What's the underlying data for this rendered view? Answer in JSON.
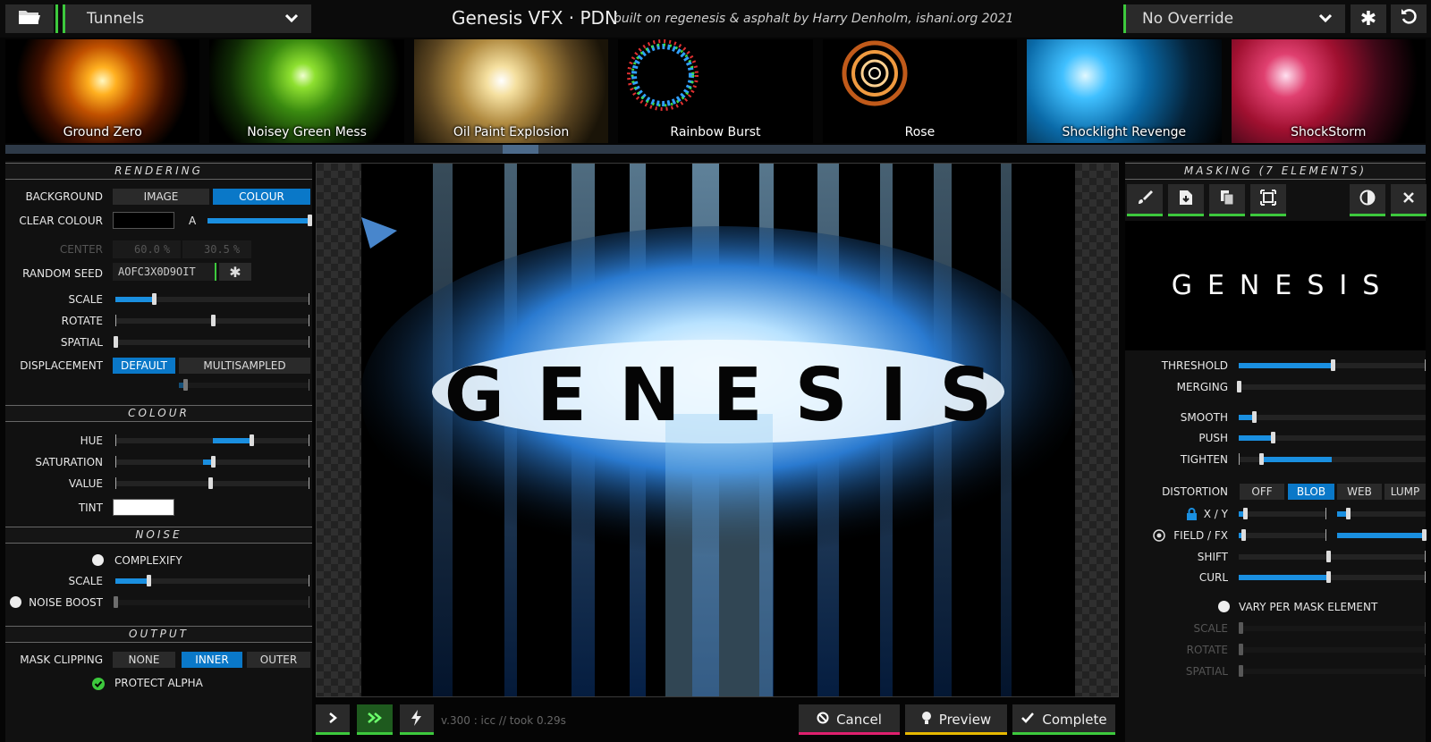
{
  "header": {
    "preset": "Tunnels",
    "title": "Genesis VFX · PDN",
    "credit": "built on regenesis & asphalt by Harry Denholm, ishani.org 2021",
    "override": "No Override"
  },
  "presets": [
    {
      "label": "Ground Zero"
    },
    {
      "label": "Noisey Green Mess"
    },
    {
      "label": "Oil Paint Explosion"
    },
    {
      "label": "Rainbow Burst"
    },
    {
      "label": "Rose"
    },
    {
      "label": "Shocklight Revenge"
    },
    {
      "label": "ShockStorm"
    }
  ],
  "rendering": {
    "heading": "RENDERING",
    "background_label": "BACKGROUND",
    "background_options": [
      "IMAGE",
      "COLOUR"
    ],
    "background_selected": "COLOUR",
    "clear_colour_label": "CLEAR COLOUR",
    "clear_colour": "#000000",
    "alpha_label": "A",
    "alpha_value": 1.0,
    "center_label": "CENTER",
    "center_x": "60.0",
    "center_y": "30.5",
    "pct": "%",
    "seed_label": "RANDOM SEED",
    "seed": "AOFC3X0D9OIT",
    "scale_label": "SCALE",
    "scale_value": 0.2,
    "rotate_label": "ROTATE",
    "rotate_value": 0.5,
    "spatial_label": "SPATIAL",
    "spatial_value": 0.0,
    "displacement_label": "DISPLACEMENT",
    "displacement_options": [
      "DEFAULT",
      "MULTISAMPLED"
    ],
    "displacement_selected": "DEFAULT",
    "displacement_amount": 0.05
  },
  "colour": {
    "heading": "COLOUR",
    "hue_label": "HUE",
    "hue_value": 0.7,
    "saturation_label": "SATURATION",
    "saturation_value": 0.5,
    "value_label": "VALUE",
    "value_value": 0.49,
    "tint_label": "TINT",
    "tint": "#ffffff"
  },
  "noise": {
    "heading": "NOISE",
    "complexify_label": "COMPLEXIFY",
    "scale_label": "SCALE",
    "scale_value": 0.17,
    "boost_label": "NOISE BOOST",
    "boost_value": 0.0
  },
  "output": {
    "heading": "OUTPUT",
    "mask_clipping_label": "MASK CLIPPING",
    "mask_options": [
      "NONE",
      "INNER",
      "OUTER"
    ],
    "mask_selected": "INNER",
    "protect_alpha_label": "PROTECT ALPHA"
  },
  "canvas": {
    "render_text": "GENESIS"
  },
  "footer": {
    "status": "v.300 : icc // took 0.29s",
    "cancel": "Cancel",
    "preview": "Preview",
    "complete": "Complete"
  },
  "masking": {
    "heading": "MASKING (7 ELEMENTS)",
    "preview_text": "GENESIS",
    "threshold_label": "THRESHOLD",
    "threshold_value": 0.5,
    "merging_label": "MERGING",
    "merging_value": 0.0,
    "smooth_label": "SMOOTH",
    "smooth_value": 0.08,
    "push_label": "PUSH",
    "push_value": 0.18,
    "tighten_label": "TIGHTEN",
    "tighten_value": 0.12,
    "distortion_label": "DISTORTION",
    "distortion_options": [
      "OFF",
      "BLOB",
      "WEB",
      "LUMP"
    ],
    "distortion_selected": "BLOB",
    "xy_label": "X / Y",
    "field_label": "FIELD / FX",
    "shift_label": "SHIFT",
    "shift_value": 0.48,
    "curl_label": "CURL",
    "curl_value": 0.48,
    "vary_label": "VARY PER MASK ELEMENT",
    "vary_scale_label": "SCALE",
    "vary_rotate_label": "ROTATE",
    "vary_spatial_label": "SPATIAL"
  },
  "colors": {
    "accent_blue": "#0a78c8",
    "accent_green": "#3dc93d",
    "cancel_underline": "#e0206e",
    "preview_underline": "#e6b800",
    "complete_underline": "#3dc93d"
  }
}
